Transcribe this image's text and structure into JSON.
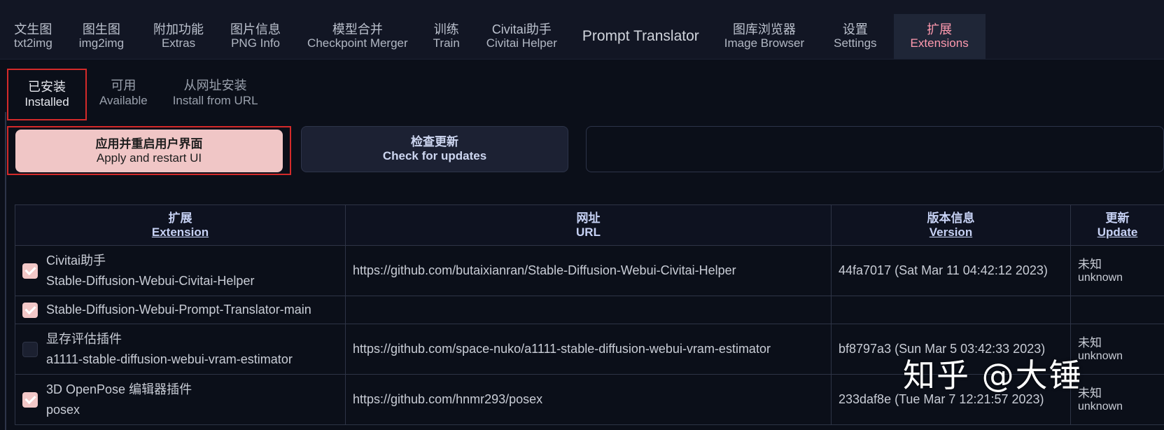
{
  "top_tabs": [
    {
      "zh": "文生图",
      "en": "txt2img"
    },
    {
      "zh": "图生图",
      "en": "img2img"
    },
    {
      "zh": "附加功能",
      "en": "Extras"
    },
    {
      "zh": "图片信息",
      "en": "PNG Info"
    },
    {
      "zh": "模型合并",
      "en": "Checkpoint Merger"
    },
    {
      "zh": "训练",
      "en": "Train"
    },
    {
      "zh": "Civitai助手",
      "en": "Civitai Helper"
    },
    {
      "single": "Prompt Translator"
    },
    {
      "zh": "图库浏览器",
      "en": "Image Browser"
    },
    {
      "zh": "设置",
      "en": "Settings"
    },
    {
      "zh": "扩展",
      "en": "Extensions"
    }
  ],
  "sub_tabs": [
    {
      "zh": "已安装",
      "en": "Installed"
    },
    {
      "zh": "可用",
      "en": "Available"
    },
    {
      "zh": "从网址安装",
      "en": "Install from URL"
    }
  ],
  "buttons": {
    "apply": {
      "zh": "应用并重启用户界面",
      "en": "Apply and restart UI"
    },
    "check": {
      "zh": "检查更新",
      "en": "Check for updates"
    }
  },
  "table": {
    "headers": {
      "extension": {
        "zh": "扩展",
        "en": "Extension"
      },
      "url": {
        "zh": "网址",
        "en": "URL"
      },
      "version": {
        "zh": "版本信息",
        "en": "Version"
      },
      "update": {
        "zh": "更新",
        "en": "Update"
      }
    },
    "rows": [
      {
        "checked": true,
        "name_zh": "Civitai助手",
        "name": "Stable-Diffusion-Webui-Civitai-Helper",
        "url": "https://github.com/butaixianran/Stable-Diffusion-Webui-Civitai-Helper",
        "version": "44fa7017 (Sat Mar 11 04:42:12 2023)",
        "update_zh": "未知",
        "update_en": "unknown"
      },
      {
        "checked": true,
        "name_zh": "",
        "name": "Stable-Diffusion-Webui-Prompt-Translator-main",
        "url": "",
        "version": "",
        "update_zh": "",
        "update_en": ""
      },
      {
        "checked": false,
        "name_zh": "显存评估插件",
        "name": "a1111-stable-diffusion-webui-vram-estimator",
        "url": "https://github.com/space-nuko/a1111-stable-diffusion-webui-vram-estimator",
        "version": "bf8797a3 (Sun Mar 5 03:42:33 2023)",
        "update_zh": "未知",
        "update_en": "unknown"
      },
      {
        "checked": true,
        "name_zh": "3D OpenPose 编辑器插件",
        "name": "posex",
        "url": "https://github.com/hnmr293/posex",
        "version": "233daf8e (Tue Mar 7 12:21:57 2023)",
        "update_zh": "未知",
        "update_en": "unknown"
      }
    ]
  },
  "watermark": "知乎 @大锤",
  "colors": {
    "background": "#0b0f19",
    "active_tab_text": "#ff8aa3",
    "apply_button": "#f0c6c6",
    "highlight_border": "#d42a2a",
    "checkbox_on": "#f2c7c7"
  }
}
